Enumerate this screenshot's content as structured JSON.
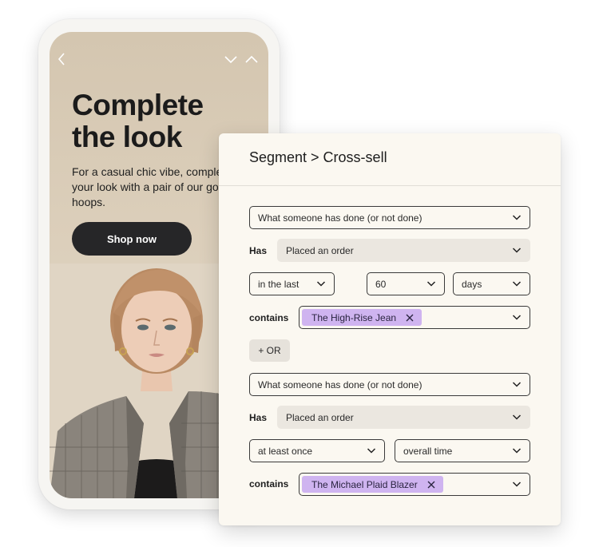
{
  "phone": {
    "headline_line1": "Complete",
    "headline_line2": "the look",
    "subtext": "For a casual chic vibe, complete your look with a pair of our golden hoops.",
    "shop_button": "Shop now",
    "icons": [
      "chevron-left-icon",
      "chevron-down-icon",
      "chevron-up-icon"
    ]
  },
  "panel": {
    "title": "Segment > Cross-sell",
    "group1": {
      "condition": "What someone has done (or not done)",
      "has_label": "Has",
      "action": "Placed an order",
      "timeframe": "in the last",
      "amount": "60",
      "unit": "days",
      "contains_label": "contains",
      "product_tag": "The High-Rise Jean"
    },
    "or_button": "+ OR",
    "group2": {
      "condition": "What someone has done (or not done)",
      "has_label": "Has",
      "action": "Placed an order",
      "frequency": "at least once",
      "period": "overall time",
      "contains_label": "contains",
      "product_tag": "The Michael Plaid Blazer"
    }
  },
  "colors": {
    "accent_chip": "#cfb4f0",
    "button_dark": "#262628",
    "panel_bg": "#fbf8f1",
    "phone_bg": "#d4c6b0"
  }
}
